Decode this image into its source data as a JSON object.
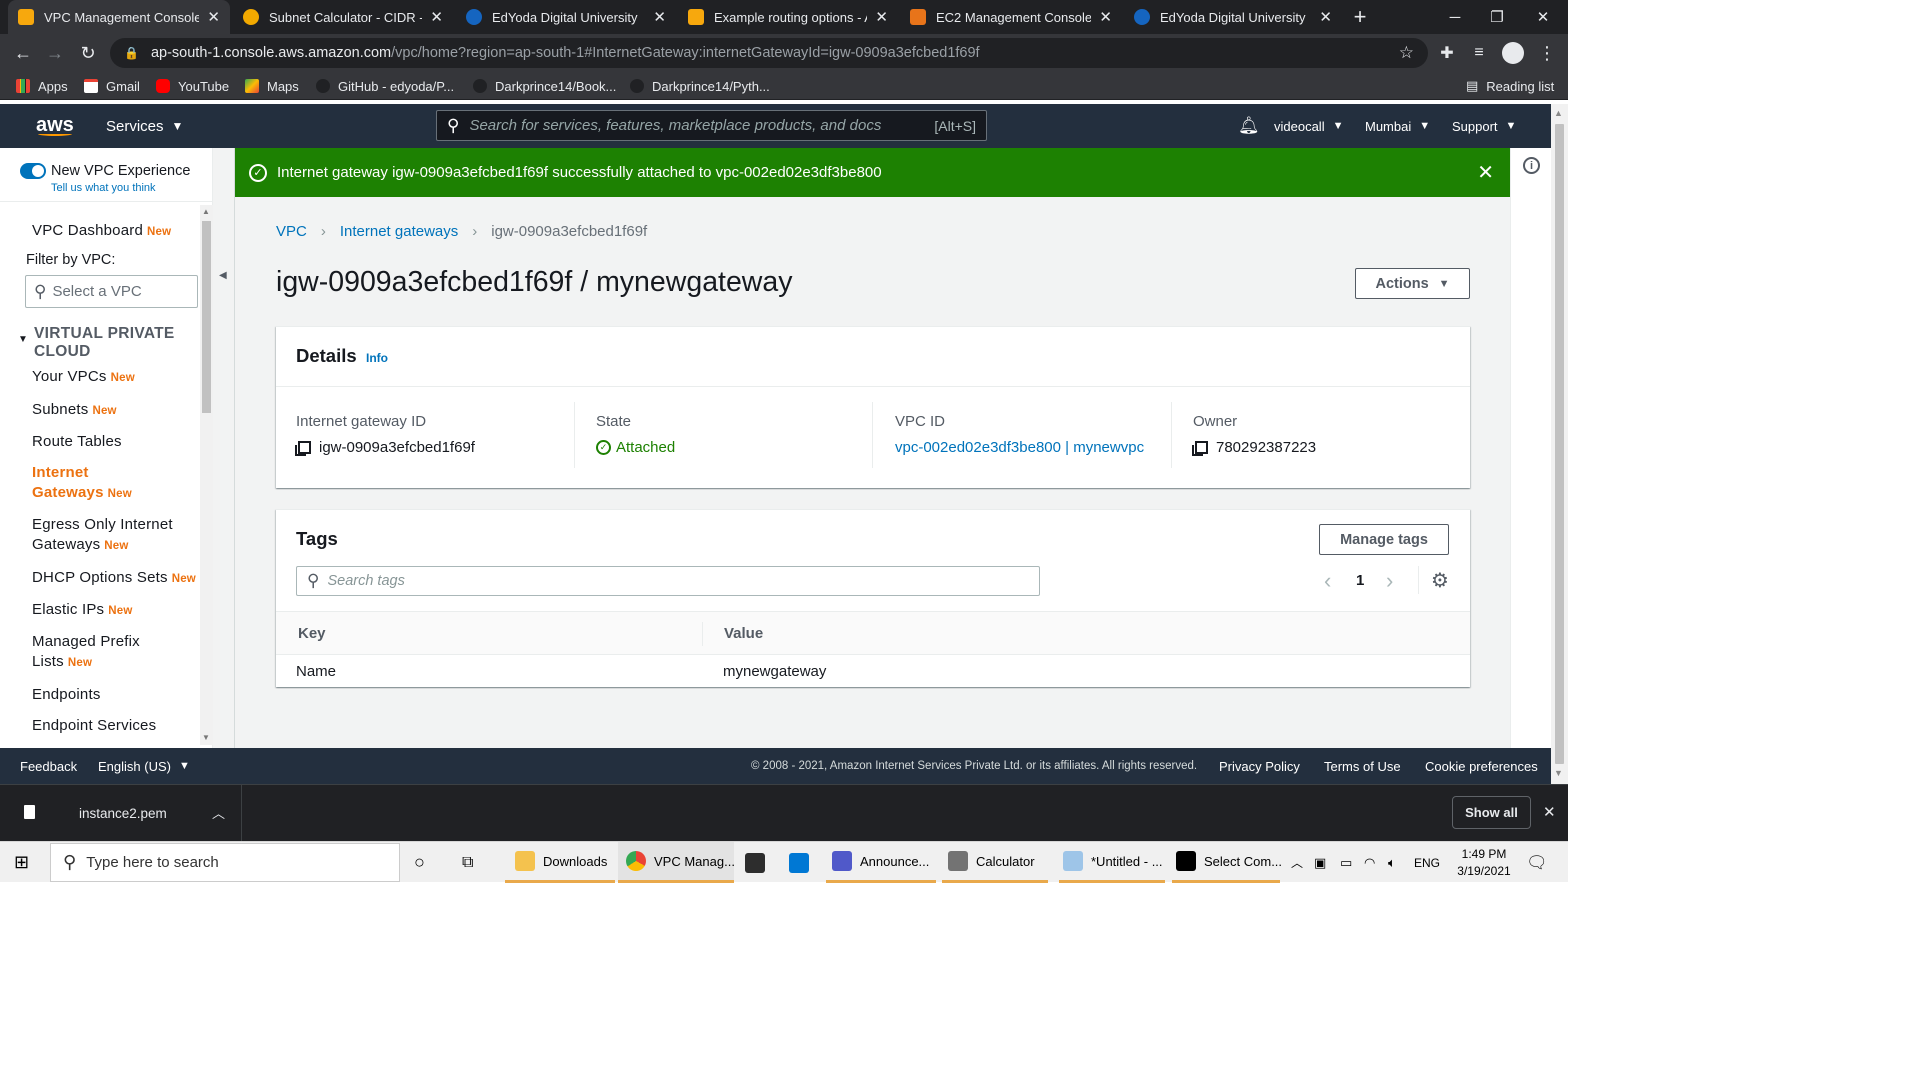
{
  "browser": {
    "tabs": [
      {
        "title": "VPC Management Console",
        "active": true,
        "icon": "aws-cube-icon"
      },
      {
        "title": "Subnet Calculator - CIDR - IP",
        "icon": "subnet-calc-icon"
      },
      {
        "title": "EdYoda Digital University",
        "icon": "edge-e-icon"
      },
      {
        "title": "Example routing options - An",
        "icon": "aws-docs-icon"
      },
      {
        "title": "EC2 Management Console",
        "icon": "aws-ec2-icon"
      },
      {
        "title": "EdYoda Digital University",
        "icon": "edge-e-icon"
      }
    ],
    "url_host": "ap-south-1.console.aws.amazon.com",
    "url_path": "/vpc/home?region=ap-south-1#InternetGateway:internetGatewayId=igw-0909a3efcbed1f69f",
    "bookmarks": [
      "Apps",
      "Gmail",
      "YouTube",
      "Maps",
      "GitHub - edyoda/P...",
      "Darkprince14/Book...",
      "Darkprince14/Pyth..."
    ],
    "reading_list": "Reading list"
  },
  "aws_header": {
    "services": "Services",
    "search_placeholder": "Search for services, features, marketplace products, and docs",
    "search_shortcut": "[Alt+S]",
    "account": "videocall",
    "region": "Mumbai",
    "support": "Support"
  },
  "sidebar": {
    "new_vpc_experience": "New VPC Experience",
    "feedback_link": "Tell us what you think",
    "dashboard": "VPC Dashboard",
    "new_badge": "New",
    "filter_label": "Filter by VPC:",
    "filter_placeholder": "Select a VPC",
    "section": "VIRTUAL PRIVATE CLOUD",
    "items": [
      {
        "line1": "Your VPCs",
        "line2": "",
        "new": true
      },
      {
        "line1": "Subnets",
        "line2": "",
        "new": true
      },
      {
        "line1": "Route Tables",
        "line2": "",
        "new": false
      },
      {
        "line1": "Internet",
        "line2": "Gateways",
        "new": true,
        "active": true
      },
      {
        "line1": "Egress Only Internet",
        "line2": "Gateways",
        "new": true
      },
      {
        "line1": "DHCP Options Sets",
        "line2": "",
        "new": true
      },
      {
        "line1": "Elastic IPs",
        "line2": "",
        "new": true
      },
      {
        "line1": "Managed Prefix",
        "line2": "Lists",
        "new": true
      },
      {
        "line1": "Endpoints",
        "line2": "",
        "new": false
      },
      {
        "line1": "Endpoint Services",
        "line2": "",
        "new": false
      }
    ]
  },
  "flash": {
    "message": "Internet gateway igw-0909a3efcbed1f69f successfully attached to vpc-002ed02e3df3be800"
  },
  "breadcrumb": [
    "VPC",
    "Internet gateways",
    "igw-0909a3efcbed1f69f"
  ],
  "page_title": "igw-0909a3efcbed1f69f / mynewgateway",
  "actions_label": "Actions",
  "details": {
    "heading": "Details",
    "info": "Info",
    "fields": {
      "igw_label": "Internet gateway ID",
      "igw_value": "igw-0909a3efcbed1f69f",
      "state_label": "State",
      "state_value": "Attached",
      "vpc_label": "VPC ID",
      "vpc_value": "vpc-002ed02e3df3be800 | mynewvpc",
      "owner_label": "Owner",
      "owner_value": "780292387223"
    }
  },
  "tags": {
    "heading": "Tags",
    "manage_label": "Manage tags",
    "search_placeholder": "Search tags",
    "page": "1",
    "columns": [
      "Key",
      "Value"
    ],
    "rows": [
      {
        "key": "Name",
        "value": "mynewgateway"
      }
    ]
  },
  "footer": {
    "feedback": "Feedback",
    "language": "English (US)",
    "copyright": "© 2008 - 2021, Amazon Internet Services Private Ltd. or its affiliates. All rights reserved.",
    "privacy": "Privacy Policy",
    "terms": "Terms of Use",
    "cookies": "Cookie preferences"
  },
  "downloads": {
    "file": "instance2.pem",
    "show_all": "Show all"
  },
  "taskbar": {
    "search_placeholder": "Type here to search",
    "apps": [
      "Downloads",
      "VPC Manag...",
      "Announce...",
      "Calculator",
      "*Untitled - ...",
      "Select Com..."
    ],
    "lang": "ENG",
    "time": "1:49 PM",
    "date": "3/19/2021"
  },
  "colors": {
    "aws_nav": "#232f3e",
    "success_green": "#1d8102",
    "link_blue": "#0073bb",
    "accent_orange": "#ec7211"
  }
}
